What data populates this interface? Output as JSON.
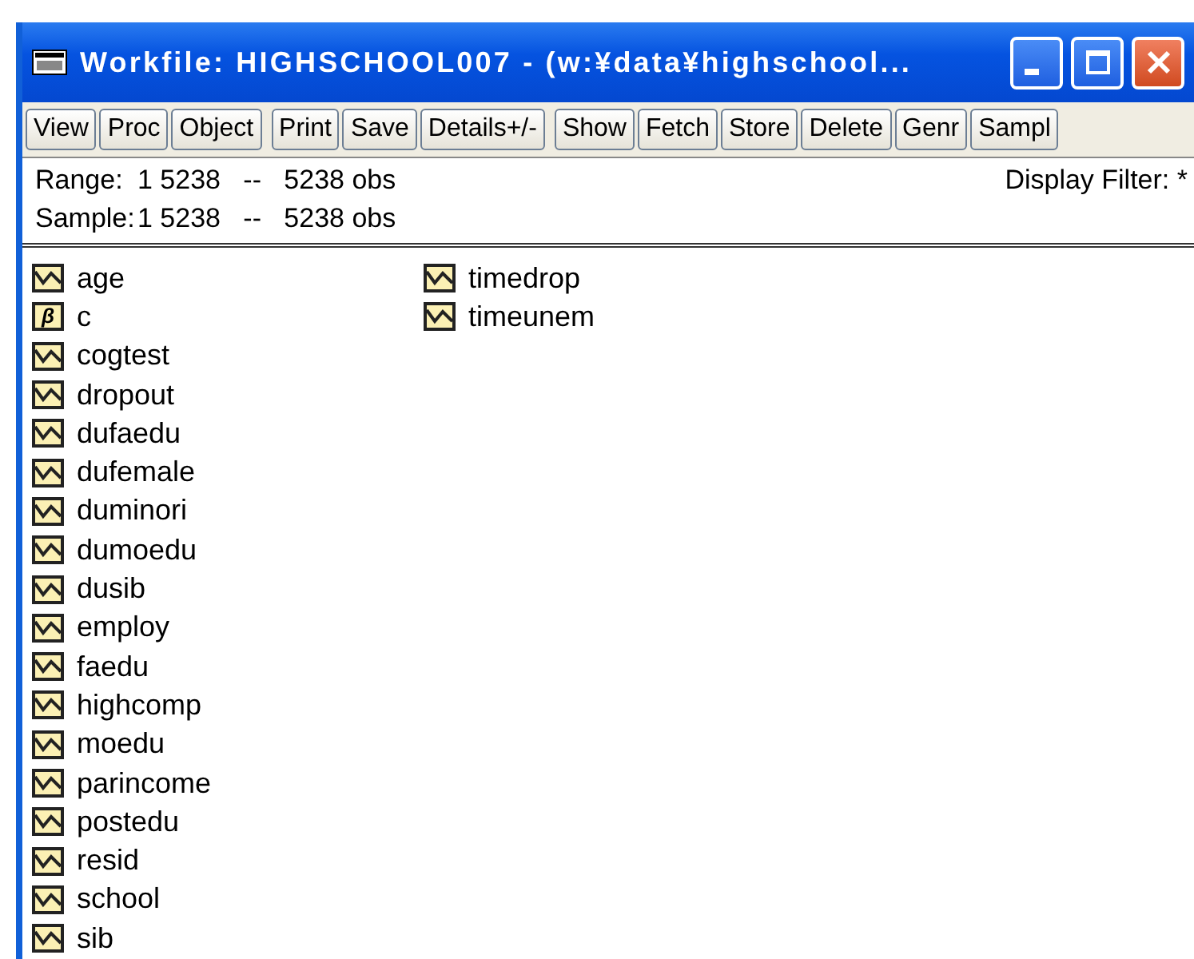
{
  "window": {
    "title": "Workfile: HIGHSCHOOL007 - (w:¥data¥highschool...",
    "controls": [
      {
        "kind": "minimize"
      },
      {
        "kind": "maximize"
      },
      {
        "kind": "close"
      }
    ]
  },
  "toolbar": [
    {
      "buttons": [
        "View",
        "Proc",
        "Object"
      ]
    },
    {
      "buttons": [
        "Print",
        "Save",
        "Details+/-"
      ]
    },
    {
      "buttons": [
        "Show",
        "Fetch",
        "Store",
        "Delete",
        "Genr",
        "Sampl"
      ]
    }
  ],
  "info": {
    "range": {
      "label": "Range:",
      "value": "1 5238   --   5238 obs"
    },
    "sample": {
      "label": "Sample:",
      "value": "1 5238   --   5238 obs"
    },
    "filter": "Display Filter: *"
  },
  "objects": [
    {
      "name": "age",
      "kind": "series"
    },
    {
      "name": "c",
      "kind": "coef",
      "glyph": "β"
    },
    {
      "name": "cogtest",
      "kind": "series"
    },
    {
      "name": "dropout",
      "kind": "series"
    },
    {
      "name": "dufaedu",
      "kind": "series"
    },
    {
      "name": "dufemale",
      "kind": "series"
    },
    {
      "name": "duminori",
      "kind": "series"
    },
    {
      "name": "dumoedu",
      "kind": "series"
    },
    {
      "name": "dusib",
      "kind": "series"
    },
    {
      "name": "employ",
      "kind": "series"
    },
    {
      "name": "faedu",
      "kind": "series"
    },
    {
      "name": "highcomp",
      "kind": "series"
    },
    {
      "name": "moedu",
      "kind": "series"
    },
    {
      "name": "parincome",
      "kind": "series"
    },
    {
      "name": "postedu",
      "kind": "series"
    },
    {
      "name": "resid",
      "kind": "series"
    },
    {
      "name": "school",
      "kind": "series"
    },
    {
      "name": "sib",
      "kind": "series"
    },
    {
      "name": "timedrop",
      "kind": "series"
    },
    {
      "name": "timeunem",
      "kind": "series"
    }
  ]
}
